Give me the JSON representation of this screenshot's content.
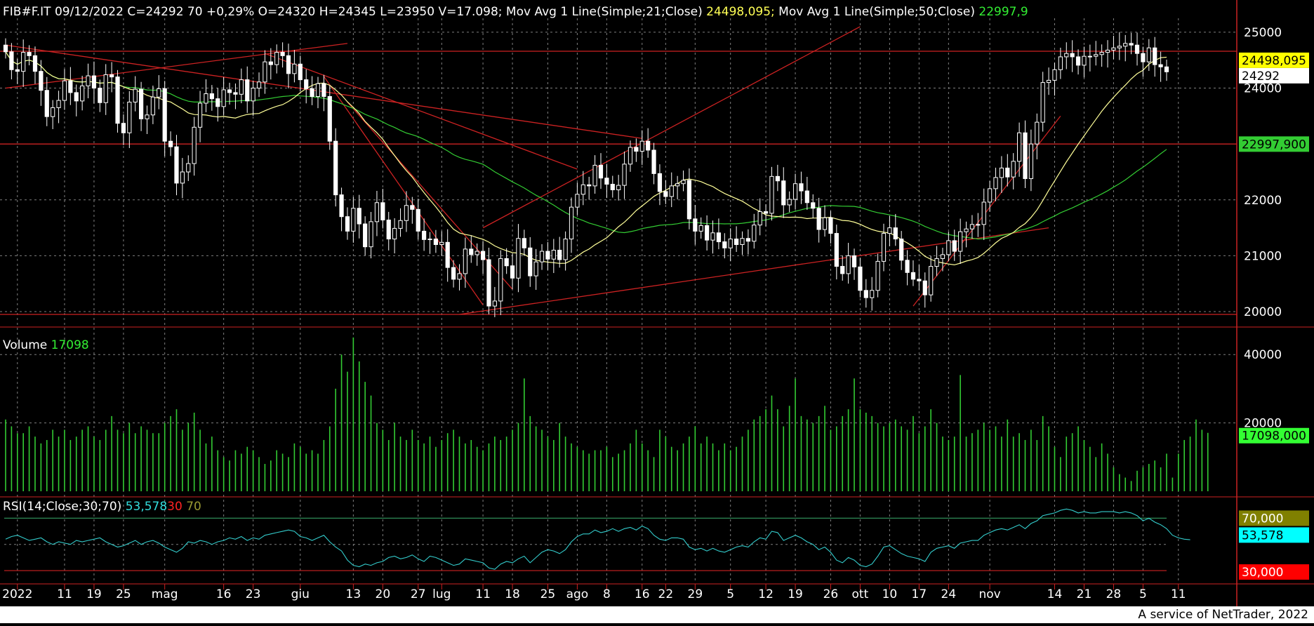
{
  "colors": {
    "bg": "#000000",
    "up": "#ffffff",
    "down": "#ffffff",
    "ma21": "#ffff99",
    "ma50": "#33cc33",
    "trend": "#cc2222",
    "grid": "#7f7f7f",
    "volume": "#33cc33",
    "rsi": "#33cccc",
    "rsiBand": "#2e8b57"
  },
  "header": {
    "symbol": "FIB#F.IT 09/12/2022 C=24292 70 +0,29% O=24320 H=24345 L=23950 V=17.098;",
    "ma21_label": " Mov Avg 1 Line(Simple;21;Close)",
    "ma21_value": " 24498,095;",
    "ma50_label": " Mov Avg 1 Line(Simple;50;Close)",
    "ma50_value": " 22997,9"
  },
  "volume_header": {
    "label": "Volume ",
    "value": "17098"
  },
  "rsi_header": {
    "label": "RSI(14;Close;30;70) ",
    "value": "53,578",
    "low": "30",
    "high": "70"
  },
  "footer": "A service of NetTrader, 2022",
  "chart_data": {
    "type": "candlestick",
    "price_axis": {
      "ticks": [
        20000,
        21000,
        22000,
        24000,
        25000
      ],
      "ylim": [
        19850,
        25200
      ]
    },
    "price_badges": [
      {
        "text": "24498,095",
        "value": 24498,
        "bg": "#ffff00",
        "fg": "#000000"
      },
      {
        "text": "24292",
        "value": 24292,
        "bg": "#ffffff",
        "fg": "#000000"
      },
      {
        "text": "22997,900",
        "value": 22998,
        "bg": "#33cc33",
        "fg": "#000000"
      }
    ],
    "horizontal_lines": [
      24660,
      23000,
      19950
    ],
    "trend_lines": [
      {
        "from": [
          0,
          24770
        ],
        "to": [
          108,
          23100
        ]
      },
      {
        "from": [
          0,
          24000
        ],
        "to": [
          58,
          24800
        ]
      },
      {
        "from": [
          44,
          24620
        ],
        "to": [
          97,
          22550
        ]
      },
      {
        "from": [
          54,
          24210
        ],
        "to": [
          81,
          20120
        ]
      },
      {
        "from": [
          58,
          23750
        ],
        "to": [
          86,
          20400
        ]
      },
      {
        "from": [
          77,
          19950
        ],
        "to": [
          177,
          21500
        ]
      },
      {
        "from": [
          81,
          21500
        ],
        "to": [
          145,
          25100
        ]
      },
      {
        "from": [
          154,
          20100
        ],
        "to": [
          179,
          23500
        ]
      }
    ],
    "x_labels": [
      {
        "label": "2022",
        "idx": 2
      },
      {
        "label": "11",
        "idx": 10
      },
      {
        "label": "19",
        "idx": 15
      },
      {
        "label": "25",
        "idx": 20
      },
      {
        "label": "mag",
        "idx": 27
      },
      {
        "label": "16",
        "idx": 37
      },
      {
        "label": "23",
        "idx": 42
      },
      {
        "label": "giu",
        "idx": 50
      },
      {
        "label": "13",
        "idx": 59
      },
      {
        "label": "20",
        "idx": 64
      },
      {
        "label": "27",
        "idx": 70
      },
      {
        "label": "lug",
        "idx": 74
      },
      {
        "label": "11",
        "idx": 81
      },
      {
        "label": "18",
        "idx": 86
      },
      {
        "label": "25",
        "idx": 92
      },
      {
        "label": "ago",
        "idx": 97
      },
      {
        "label": "8",
        "idx": 102
      },
      {
        "label": "16",
        "idx": 108
      },
      {
        "label": "22",
        "idx": 112
      },
      {
        "label": "29",
        "idx": 117
      },
      {
        "label": "5",
        "idx": 123
      },
      {
        "label": "12",
        "idx": 129
      },
      {
        "label": "19",
        "idx": 134
      },
      {
        "label": "26",
        "idx": 140
      },
      {
        "label": "ott",
        "idx": 145
      },
      {
        "label": "10",
        "idx": 150
      },
      {
        "label": "17",
        "idx": 155
      },
      {
        "label": "24",
        "idx": 160
      },
      {
        "label": "nov",
        "idx": 167
      },
      {
        "label": "14",
        "idx": 178
      },
      {
        "label": "21",
        "idx": 183
      },
      {
        "label": "28",
        "idx": 188
      },
      {
        "label": "5",
        "idx": 193
      },
      {
        "label": "11",
        "idx": 199
      }
    ],
    "candles_close": [
      24650,
      24330,
      24300,
      24640,
      24580,
      24300,
      23960,
      23490,
      23650,
      23780,
      24130,
      23920,
      23770,
      24040,
      24220,
      24000,
      23740,
      24240,
      24200,
      23370,
      23200,
      23750,
      23980,
      23450,
      23520,
      23840,
      23990,
      23050,
      22950,
      22300,
      22500,
      22650,
      23300,
      23730,
      23900,
      23810,
      23670,
      23970,
      23920,
      23890,
      24150,
      23770,
      24000,
      24110,
      24470,
      24420,
      24640,
      24580,
      24260,
      24430,
      24150,
      23990,
      23850,
      24080,
      23850,
      23050,
      22090,
      21700,
      21440,
      21850,
      21570,
      21160,
      21610,
      21950,
      21640,
      21300,
      21490,
      21630,
      21900,
      21830,
      21440,
      21290,
      21300,
      21200,
      21240,
      20790,
      20580,
      20680,
      21120,
      21020,
      21080,
      20930,
      20100,
      20190,
      20950,
      20820,
      20600,
      21310,
      21140,
      20640,
      20890,
      21080,
      20940,
      21100,
      20930,
      21300,
      21870,
      22100,
      22270,
      22250,
      22620,
      22390,
      22280,
      22180,
      22260,
      22640,
      22940,
      22870,
      23050,
      22890,
      22470,
      22150,
      22060,
      22250,
      22290,
      22350,
      21660,
      21440,
      21540,
      21280,
      21410,
      21250,
      21140,
      21300,
      21200,
      21310,
      21260,
      21550,
      21790,
      21760,
      22420,
      22340,
      21910,
      22010,
      22290,
      22160,
      21950,
      21850,
      21470,
      21680,
      21400,
      20810,
      20680,
      21000,
      20800,
      20380,
      20250,
      20380,
      20900,
      21400,
      21500,
      21300,
      20920,
      20700,
      20580,
      20550,
      20300,
      20810,
      20950,
      21020,
      21270,
      21080,
      21430,
      21480,
      21560,
      21560,
      21960,
      22200,
      22400,
      22570,
      22410,
      22690,
      23200,
      22380,
      23000,
      23390,
      24100,
      24140,
      24330,
      24560,
      24620,
      24560,
      24410,
      24570,
      24570,
      24600,
      24640,
      24680,
      24720,
      24750,
      24800,
      24770,
      24620,
      24470,
      24720,
      24420,
      24380,
      24292
    ],
    "volume_axis": {
      "ticks": [
        20000,
        40000
      ],
      "ylim": [
        0,
        46000
      ],
      "badge": "17098,000"
    },
    "volume_values": [
      21000,
      19000,
      17000,
      17000,
      19000,
      16000,
      14000,
      15000,
      18000,
      16000,
      18000,
      15000,
      16000,
      18000,
      19000,
      16000,
      15000,
      18000,
      22000,
      18000,
      17000,
      20000,
      17000,
      19000,
      18000,
      17000,
      17000,
      20000,
      22000,
      24000,
      18000,
      20000,
      23000,
      18000,
      14000,
      16000,
      12000,
      10000,
      9000,
      12000,
      11000,
      13000,
      12000,
      10000,
      8000,
      9000,
      12000,
      11000,
      10000,
      14000,
      13000,
      11000,
      12000,
      11000,
      15000,
      19000,
      30000,
      40000,
      35000,
      45000,
      38000,
      32000,
      28000,
      20000,
      18000,
      15000,
      20000,
      16000,
      15000,
      18000,
      15000,
      14000,
      16000,
      13000,
      15000,
      17000,
      18000,
      16000,
      14000,
      15000,
      13000,
      12000,
      14000,
      16000,
      15000,
      16000,
      18000,
      20000,
      33000,
      22000,
      19000,
      18000,
      16000,
      15000,
      20000,
      16000,
      14000,
      13000,
      12000,
      11000,
      12000,
      12000,
      13000,
      10000,
      11000,
      12000,
      14000,
      18000,
      14000,
      12000,
      10000,
      18000,
      16000,
      13000,
      12000,
      14000,
      16000,
      19000,
      14000,
      16000,
      14000,
      12000,
      14000,
      12000,
      13000,
      16000,
      18000,
      21000,
      22000,
      24000,
      28000,
      24000,
      19000,
      25000,
      33000,
      22000,
      21000,
      20000,
      22000,
      25000,
      18000,
      19000,
      22000,
      24000,
      33000,
      24000,
      23000,
      22000,
      20000,
      19000,
      20000,
      21000,
      19000,
      18000,
      22000,
      17000,
      19000,
      24000,
      20000,
      16000,
      15000,
      16000,
      34000,
      16000,
      17000,
      18000,
      20000,
      18000,
      19000,
      16000,
      21000,
      16000,
      17000,
      15000,
      18000,
      15000,
      22000,
      19000,
      13000,
      10000,
      16000,
      17000,
      19000,
      15000,
      13000,
      10000,
      14000,
      11000,
      7000,
      5000,
      4000,
      3000,
      6000,
      7000,
      8000,
      9000,
      7000,
      11000,
      4000,
      11000,
      15000,
      16000,
      21000,
      18000,
      17098
    ],
    "rsi_axis": {
      "ylim": [
        22,
        82
      ],
      "levels": [
        30,
        70
      ],
      "badges": [
        {
          "text": "70,000",
          "value": 70,
          "bg": "#808000"
        },
        {
          "text": "53,578",
          "value": 53.578,
          "bg": "#00ffff"
        },
        {
          "text": "30,000",
          "value": 30,
          "bg": "#ff0000"
        }
      ]
    },
    "rsi_values": [
      54,
      56,
      57,
      55,
      53,
      54,
      55,
      52,
      50,
      52,
      51,
      50,
      53,
      52,
      53,
      54,
      55,
      52,
      50,
      48,
      49,
      51,
      53,
      50,
      52,
      53,
      51,
      48,
      46,
      44,
      47,
      52,
      51,
      53,
      52,
      50,
      52,
      53,
      55,
      54,
      56,
      53,
      55,
      54,
      57,
      58,
      59,
      60,
      61,
      60,
      56,
      55,
      53,
      55,
      57,
      52,
      48,
      45,
      38,
      34,
      33,
      35,
      34,
      36,
      37,
      40,
      41,
      39,
      40,
      42,
      39,
      37,
      41,
      40,
      38,
      36,
      34,
      35,
      39,
      38,
      37,
      36,
      32,
      31,
      35,
      37,
      36,
      39,
      41,
      36,
      40,
      44,
      46,
      45,
      43,
      46,
      52,
      56,
      58,
      58,
      61,
      59,
      60,
      62,
      60,
      62,
      63,
      61,
      64,
      62,
      57,
      54,
      53,
      55,
      55,
      54,
      48,
      46,
      47,
      45,
      47,
      45,
      44,
      46,
      48,
      49,
      48,
      52,
      55,
      54,
      60,
      59,
      53,
      55,
      57,
      55,
      52,
      50,
      46,
      48,
      44,
      38,
      36,
      40,
      38,
      34,
      33,
      35,
      41,
      48,
      49,
      46,
      43,
      41,
      40,
      39,
      37,
      44,
      47,
      48,
      49,
      47,
      51,
      52,
      53,
      53,
      57,
      59,
      61,
      62,
      61,
      63,
      65,
      62,
      66,
      68,
      72,
      73,
      74,
      76,
      77,
      76,
      74,
      75,
      74,
      74,
      75,
      75,
      75,
      74,
      75,
      74,
      72,
      68,
      70,
      67,
      65,
      62,
      57,
      55,
      54,
      53.578
    ]
  }
}
